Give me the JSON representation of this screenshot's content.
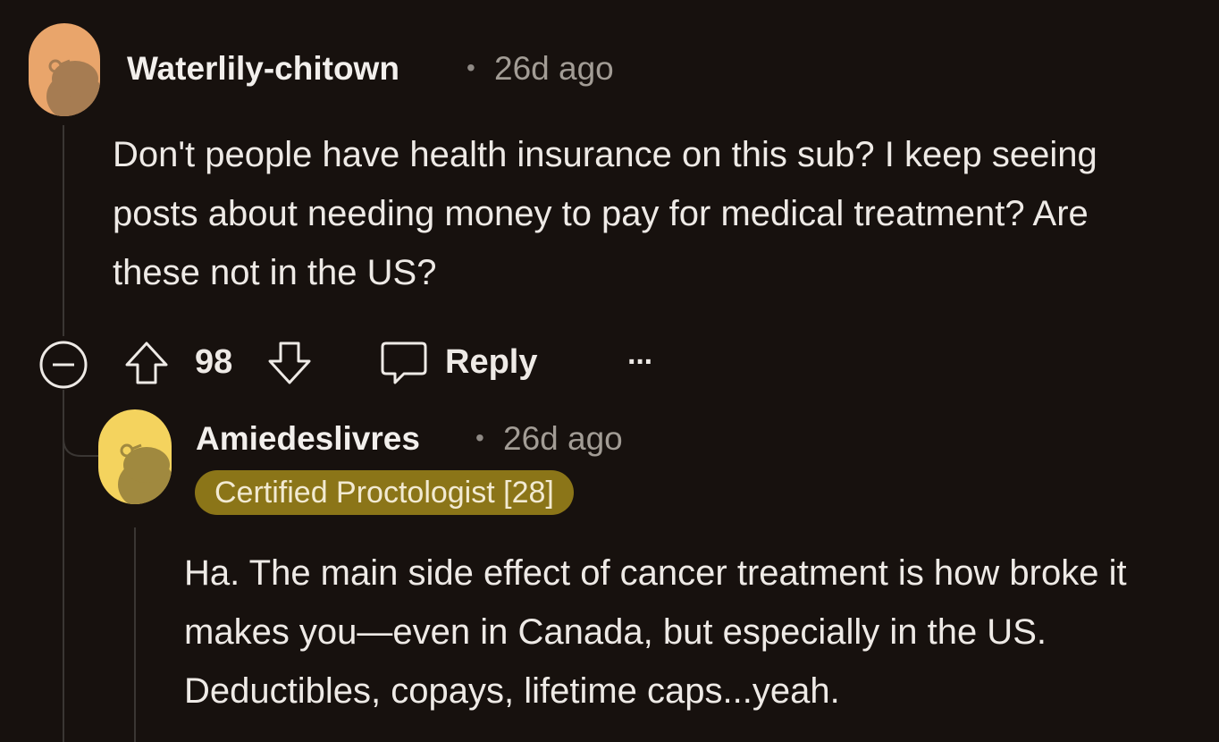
{
  "comments": [
    {
      "username": "Waterlily-chitown",
      "separator": "•",
      "time": "26d ago",
      "body": "Don't people have health insurance on this sub? I keep seeing posts about needing money to pay for medical treatment? Are these not in the US?",
      "avatar_color": "#e9a56b",
      "actions": {
        "collapse_icon": "minus-circle-icon",
        "upvote_icon": "arrow-up-icon",
        "score": "98",
        "downvote_icon": "arrow-down-icon",
        "reply_icon": "speech-bubble-icon",
        "reply_label": "Reply",
        "more_label": "···"
      }
    },
    {
      "username": "Amiedeslivres",
      "separator": "•",
      "time": "26d ago",
      "flair": "Certified Proctologist [28]",
      "flair_color": "#8b7518",
      "avatar_color": "#f4d35e",
      "body": "Ha. The main side effect of cancer treatment is how broke it makes you—even in Canada, but especially in the US. Deductibles, copays, lifetime caps...yeah."
    }
  ]
}
